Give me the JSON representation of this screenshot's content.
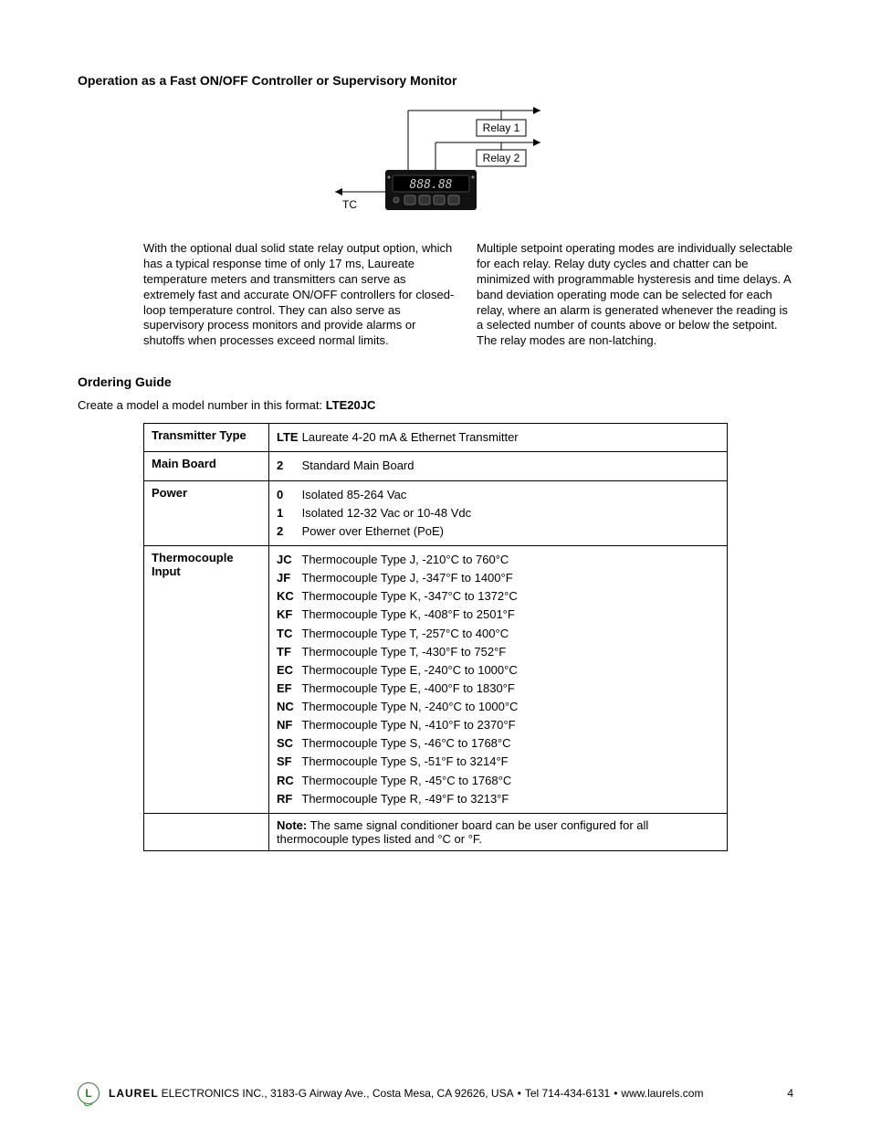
{
  "headings": {
    "section1": "Operation as a Fast ON/OFF Controller or Supervisory Monitor",
    "section2": "Ordering Guide"
  },
  "diagram": {
    "relay1": "Relay 1",
    "relay2": "Relay 2",
    "tc": "TC",
    "display": "888.88"
  },
  "para": {
    "left": "With the optional dual solid state relay output option, which has a typical response time of only 17 ms, Laureate temperature meters and transmitters can serve as extremely fast and accurate ON/OFF controllers for closed-loop temperature control. They can also serve as supervisory process monitors and provide alarms or shutoffs when processes exceed normal limits.",
    "right": "Multiple setpoint operating modes are individually selectable for each relay. Relay duty cycles and chatter can be minimized with programmable hysteresis and time delays. A band deviation operating mode can be selected for each relay, where an alarm is generated whenever the reading is a selected number of counts above or below the setpoint. The relay modes are non-latching."
  },
  "ordering": {
    "intro_prefix": "Create a model a model number in this format: ",
    "intro_model": "LTE20JC",
    "rows": {
      "transmitter_label": "Transmitter Type",
      "transmitter": [
        {
          "code": "LTE",
          "desc": "Laureate 4-20 mA & Ethernet Transmitter"
        }
      ],
      "mainboard_label": "Main Board",
      "mainboard": [
        {
          "code": "2",
          "desc": "Standard Main Board"
        }
      ],
      "power_label": "Power",
      "power": [
        {
          "code": "0",
          "desc": "Isolated 85-264 Vac"
        },
        {
          "code": "1",
          "desc": "Isolated 12-32 Vac or 10-48 Vdc"
        },
        {
          "code": "2",
          "desc": "Power over Ethernet (PoE)"
        }
      ],
      "thermo_label": "Thermocouple Input",
      "thermo": [
        {
          "code": "JC",
          "desc": "Thermocouple Type J, -210°C to 760°C"
        },
        {
          "code": "JF",
          "desc": "Thermocouple Type J, -347°F to 1400°F"
        },
        {
          "code": "KC",
          "desc": "Thermocouple Type K, -347°C to 1372°C"
        },
        {
          "code": "KF",
          "desc": "Thermocouple Type K, -408°F to 2501°F"
        },
        {
          "code": "TC",
          "desc": "Thermocouple Type T, -257°C to 400°C"
        },
        {
          "code": "TF",
          "desc": "Thermocouple Type T, -430°F to 752°F"
        },
        {
          "code": "EC",
          "desc": "Thermocouple Type E, -240°C to 1000°C"
        },
        {
          "code": "EF",
          "desc": "Thermocouple Type E, -400°F to 1830°F"
        },
        {
          "code": "NC",
          "desc": "Thermocouple Type N, -240°C to 1000°C"
        },
        {
          "code": "NF",
          "desc": "Thermocouple Type N, -410°F to 2370°F"
        },
        {
          "code": "SC",
          "desc": "Thermocouple Type S, -46°C to 1768°C"
        },
        {
          "code": "SF",
          "desc": "Thermocouple Type S, -51°F to 3214°F"
        },
        {
          "code": "RC",
          "desc": "Thermocouple Type R, -45°C to 1768°C"
        },
        {
          "code": "RF",
          "desc": "Thermocouple Type R, -49°F to 3213°F"
        }
      ],
      "note_label": "Note:",
      "note_text": " The same signal conditioner board can be user configured for all thermocouple types listed and °C or °F."
    }
  },
  "footer": {
    "brand": "LAUREL",
    "rest": " ELECTRONICS INC., 3183-G Airway Ave., Costa Mesa, CA 92626, USA ",
    "tel": " Tel 714-434-6131 ",
    "web": " www.laurels.com",
    "page": "4",
    "logo_letter": "L"
  }
}
